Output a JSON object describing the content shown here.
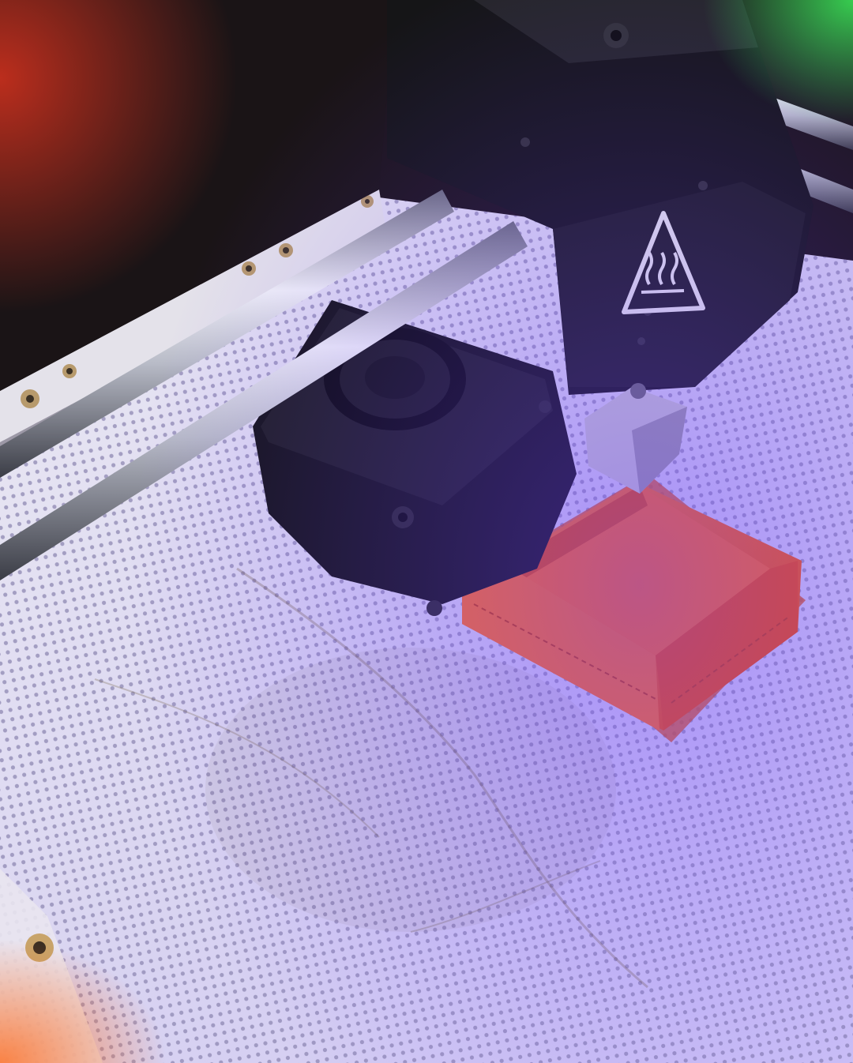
{
  "photo": {
    "subject": "3d-printer-print-head",
    "colors": {
      "bed": "#dcd8ef",
      "bed_holes": "#9a94b8",
      "frame": "#141416",
      "rod": "#c9cbd6",
      "print": "#ff5a12",
      "warning": "#e8e8ea",
      "purple_glow": "#5a2cff",
      "green_glow": "#2bd34a",
      "red_glow": "#c22a1e"
    },
    "objects": [
      "print-bed",
      "print-head-carriage",
      "cooling-fan",
      "smooth-rods",
      "printed-box",
      "hot-surface-warning-icon",
      "leveling-probe",
      "frame-rail"
    ]
  }
}
